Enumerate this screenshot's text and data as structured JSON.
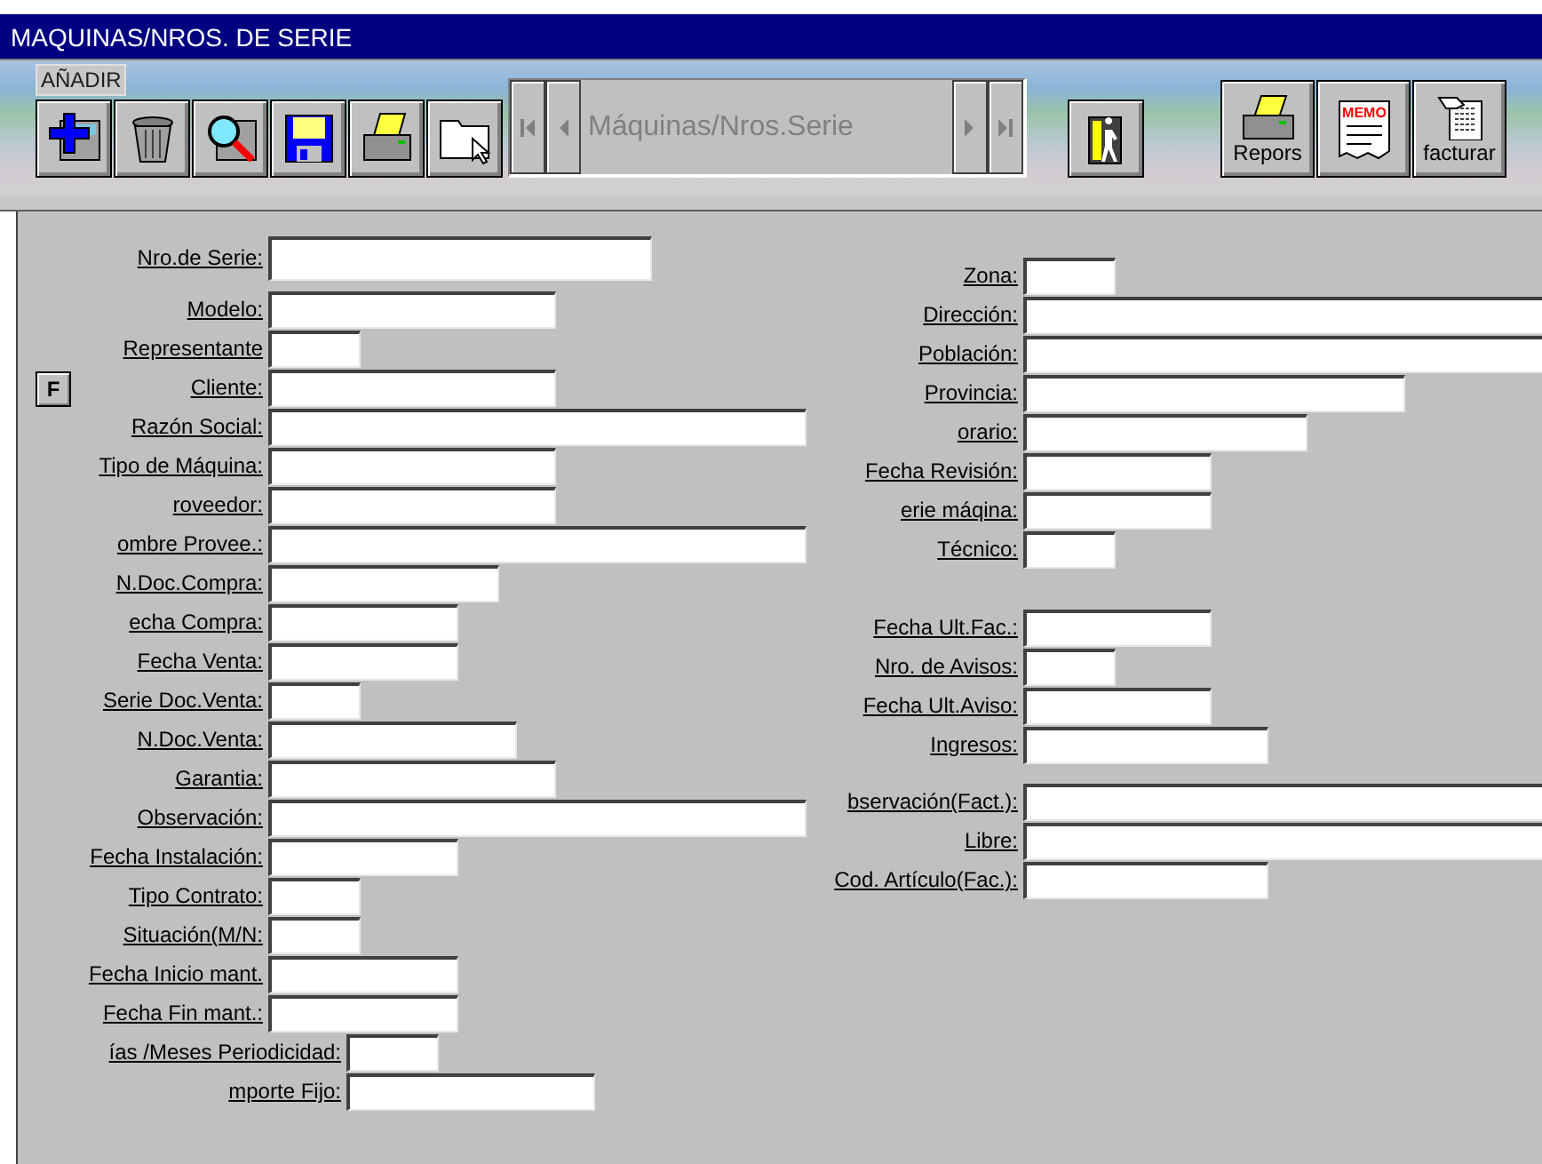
{
  "window": {
    "title": "MAQUINAS/NROS. DE SERIE"
  },
  "toolbar": {
    "tooltip": "AÑADIR",
    "navigator_label": "Máquinas/Nros.Serie",
    "report_label": "Repors",
    "memo_label": "MEMO",
    "invoice_label": "facturar"
  },
  "filter_button": {
    "label": "F"
  },
  "left_fields": [
    {
      "label": "Nro.de Serie:"
    },
    {
      "label": "Modelo:"
    },
    {
      "label": "Representante"
    },
    {
      "label": "Cliente:"
    },
    {
      "label": "Razón Social:"
    },
    {
      "label": "Tipo de Máquina:"
    },
    {
      "label": "roveedor:"
    },
    {
      "label": "ombre Provee.:"
    },
    {
      "label": "N.Doc.Compra:"
    },
    {
      "label": "echa Compra:"
    },
    {
      "label": "Fecha Venta:"
    },
    {
      "label": "Serie Doc.Venta:"
    },
    {
      "label": "N.Doc.Venta:"
    },
    {
      "label": "Garantia:"
    },
    {
      "label": "Observación:"
    },
    {
      "label": "Fecha Instalación:"
    },
    {
      "label": "Tipo Contrato:"
    },
    {
      "label": "Situación(M/N:"
    },
    {
      "label": "Fecha Inicio mant."
    },
    {
      "label": "Fecha Fin mant.:"
    },
    {
      "label": "ías /Meses Periodicidad:"
    },
    {
      "label": "mporte Fijo:"
    }
  ],
  "right_fields": [
    {
      "label": "Zona:"
    },
    {
      "label": "Dirección:"
    },
    {
      "label": "Población:"
    },
    {
      "label": "Provincia:"
    },
    {
      "label": "orario:"
    },
    {
      "label": "Fecha Revisión:"
    },
    {
      "label": "erie máqina:"
    },
    {
      "label": "Técnico:"
    },
    {
      "label": "Fecha Ult.Fac.:"
    },
    {
      "label": "Nro. de Avisos:"
    },
    {
      "label": "Fecha Ult.Aviso:"
    },
    {
      "label": "Ingresos:"
    },
    {
      "label": "bservación(Fact.):"
    },
    {
      "label": "Libre:"
    },
    {
      "label": "Cod. Artículo(Fac.):"
    }
  ]
}
